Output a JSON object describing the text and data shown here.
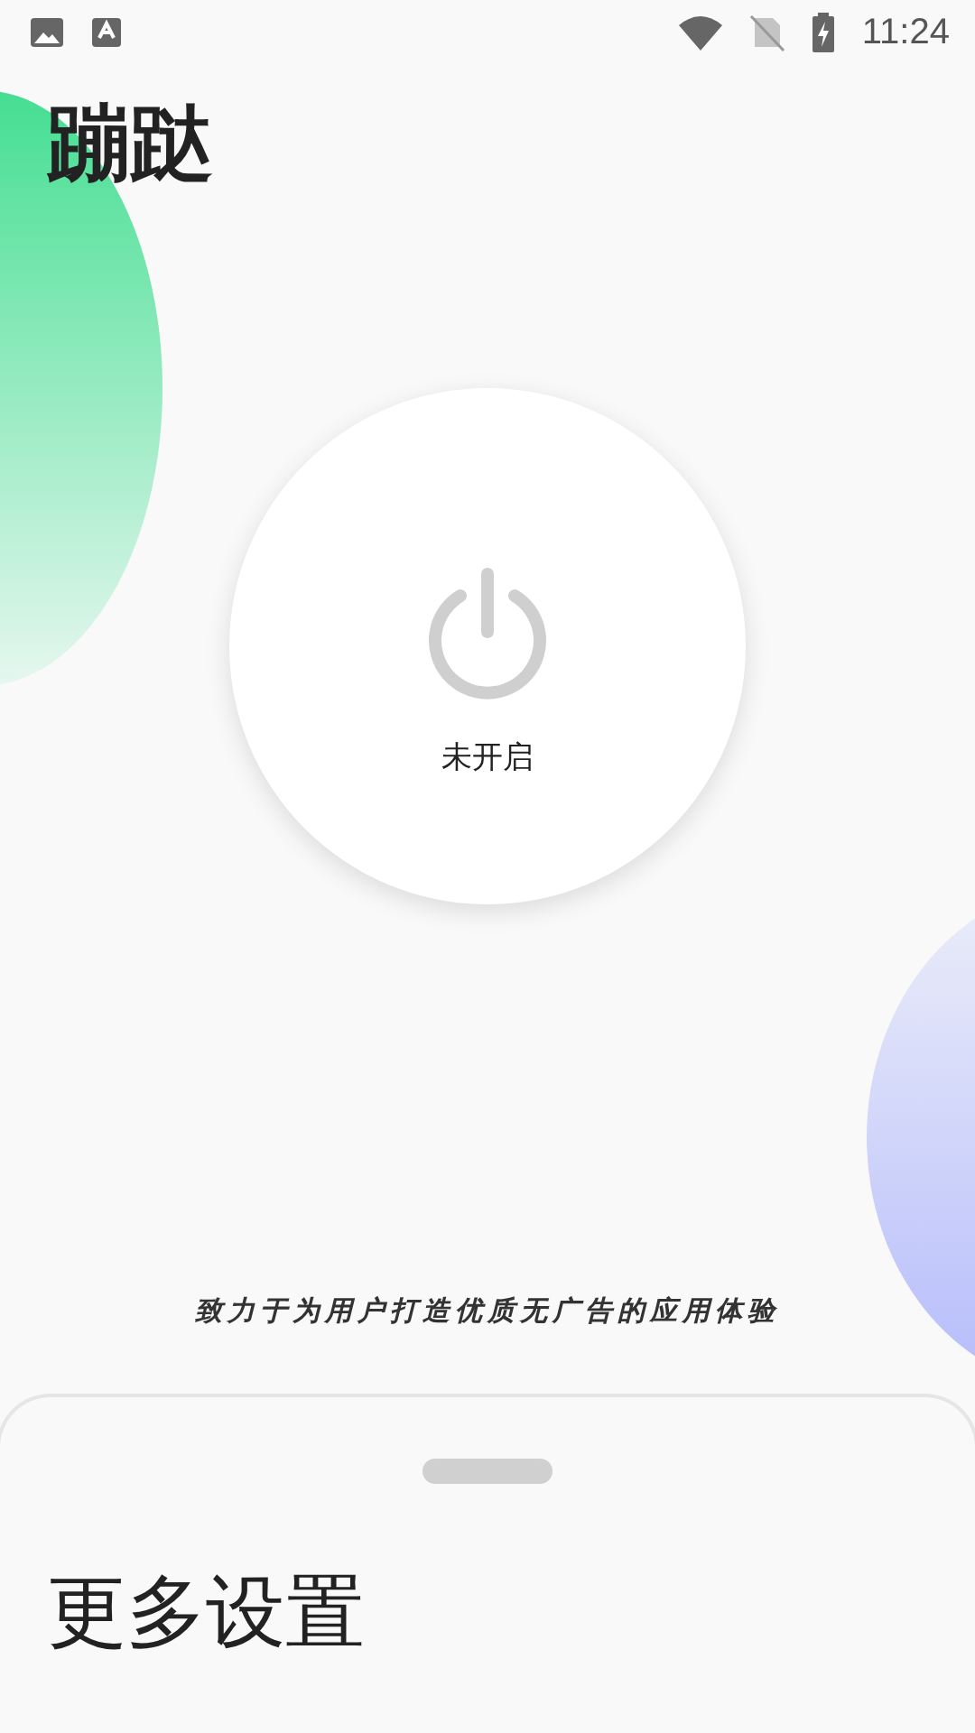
{
  "status_bar": {
    "time": "11:24"
  },
  "app": {
    "title": "蹦跶"
  },
  "power": {
    "on": false,
    "label": "未开启"
  },
  "tagline": "致力于为用户打造优质无广告的应用体验",
  "bottom_sheet": {
    "title": "更多设置"
  }
}
